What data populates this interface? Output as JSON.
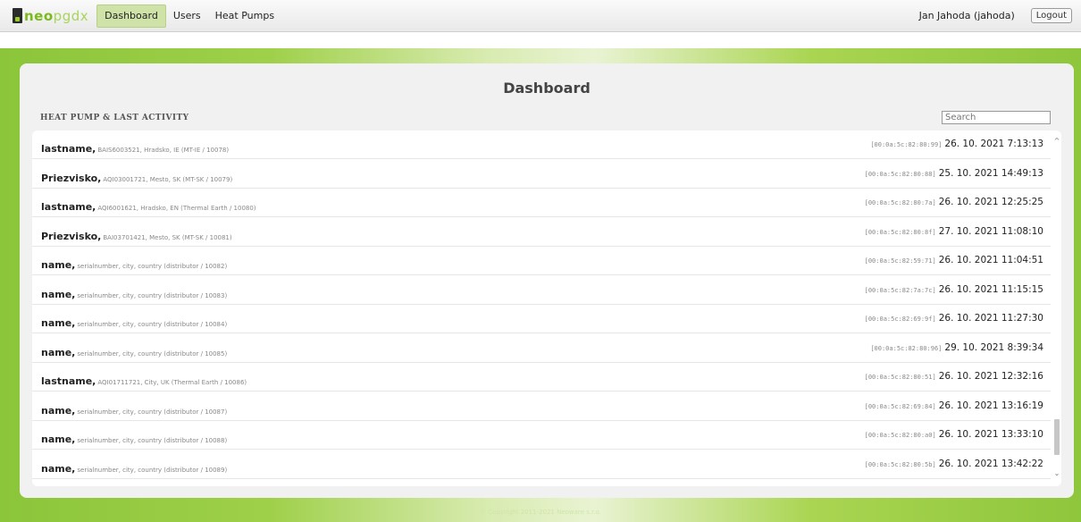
{
  "nav": {
    "logo_bold": "neo",
    "logo_light": "pgdx",
    "items": [
      {
        "label": "Dashboard"
      },
      {
        "label": "Users"
      },
      {
        "label": "Heat Pumps"
      }
    ],
    "user": "Jan Jahoda (jahoda)",
    "logout": "Logout"
  },
  "main": {
    "title": "Dashboard",
    "section_title": "HEAT PUMP & LAST ACTIVITY",
    "search_placeholder": "Search"
  },
  "rows": [
    {
      "name": "lastname,",
      "details": "BAIS6003521, Hradsko, IE (MT-IE / 10078)",
      "mac": "[00:0a:5c:82:80:99]",
      "time": "26. 10. 2021 7:13:13"
    },
    {
      "name": "Priezvisko,",
      "details": "AQI03001721, Mesto, SK (MT-SK / 10079)",
      "mac": "[00:0a:5c:82:80:88]",
      "time": "25. 10. 2021 14:49:13"
    },
    {
      "name": "lastname,",
      "details": "AQI6001621, Hradsko, EN (Thermal Earth / 10080)",
      "mac": "[00:0a:5c:82:80:7a]",
      "time": "26. 10. 2021 12:25:25"
    },
    {
      "name": "Priezvisko,",
      "details": "BAI03701421, Mesto, SK (MT-SK / 10081)",
      "mac": "[00:0a:5c:82:80:8f]",
      "time": "27. 10. 2021 11:08:10"
    },
    {
      "name": "name,",
      "details": "serialnumber, city, country (distributor / 10082)",
      "mac": "[00:0a:5c:82:59:71]",
      "time": "26. 10. 2021 11:04:51"
    },
    {
      "name": "name,",
      "details": "serialnumber, city, country (distributor / 10083)",
      "mac": "[00:0a:5c:82:7a:7c]",
      "time": "26. 10. 2021 11:15:15"
    },
    {
      "name": "name,",
      "details": "serialnumber, city, country (distributor / 10084)",
      "mac": "[00:0a:5c:82:69:9f]",
      "time": "26. 10. 2021 11:27:30"
    },
    {
      "name": "name,",
      "details": "serialnumber, city, country (distributor / 10085)",
      "mac": "[00:0a:5c:82:80:96]",
      "time": "29. 10. 2021 8:39:34"
    },
    {
      "name": "lastname,",
      "details": "AQI01711721, City, UK (Thermal Earth / 10086)",
      "mac": "[00:0a:5c:82:80:51]",
      "time": "26. 10. 2021 12:32:16"
    },
    {
      "name": "name,",
      "details": "serialnumber, city, country (distributor / 10087)",
      "mac": "[00:0a:5c:82:69:84]",
      "time": "26. 10. 2021 13:16:19"
    },
    {
      "name": "name,",
      "details": "serialnumber, city, country (distributor / 10088)",
      "mac": "[00:0a:5c:82:80:a0]",
      "time": "26. 10. 2021 13:33:10"
    },
    {
      "name": "name,",
      "details": "serialnumber, city, country (distributor / 10089)",
      "mac": "[00:0a:5c:82:80:5b]",
      "time": "26. 10. 2021 13:42:22"
    }
  ],
  "scroll": {
    "up_icon": "chevron-up-icon",
    "down_icon": "chevron-down-icon"
  },
  "footer": "© Copyright 2011-2021 Neoware s.r.o.",
  "colors": {
    "brand_green": "#7cb91d",
    "active_tab": "#cfe3a9"
  }
}
